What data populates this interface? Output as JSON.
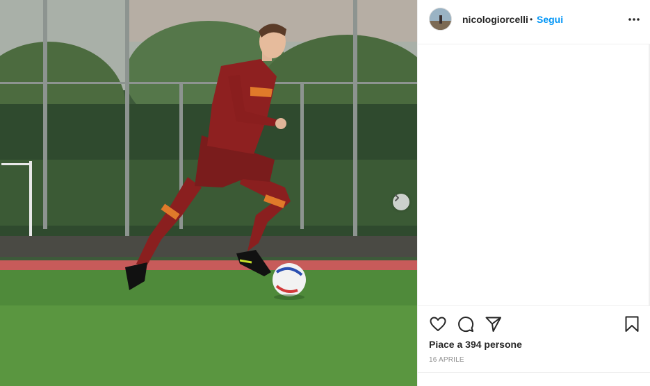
{
  "post": {
    "username": "nicologiorcelli",
    "separator": "•",
    "follow_label": "Segui",
    "likes_text": "Piace a 394 persone",
    "date_text": "16 APRILE"
  },
  "icons": {
    "more": "more-options-icon",
    "like": "heart-icon",
    "comment": "comment-icon",
    "share": "share-icon",
    "save": "bookmark-icon",
    "next": "chevron-right-icon"
  },
  "colors": {
    "accent": "#0095f6",
    "text": "#262626",
    "muted": "#8e8e8e",
    "border": "#efefef"
  }
}
